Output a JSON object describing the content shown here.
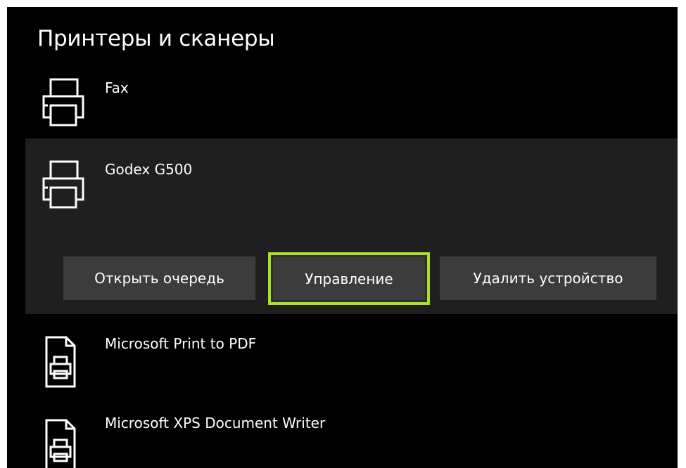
{
  "page": {
    "title": "Принтеры и сканеры"
  },
  "devices": [
    {
      "name": "Fax",
      "icon": "printer-icon"
    },
    {
      "name": "Godex G500",
      "icon": "printer-icon"
    },
    {
      "name": "Microsoft Print to PDF",
      "icon": "document-printer-icon"
    },
    {
      "name": "Microsoft XPS Document Writer",
      "icon": "document-printer-icon"
    }
  ],
  "selected_device": {
    "actions": {
      "open_queue": "Открыть очередь",
      "manage": "Управление",
      "remove_device": "Удалить устройство"
    }
  },
  "colors": {
    "background": "#000000",
    "selected_row": "#1f1f1f",
    "button": "#3c3c3c",
    "focus_outline": "#a8e226",
    "text": "#ffffff"
  }
}
